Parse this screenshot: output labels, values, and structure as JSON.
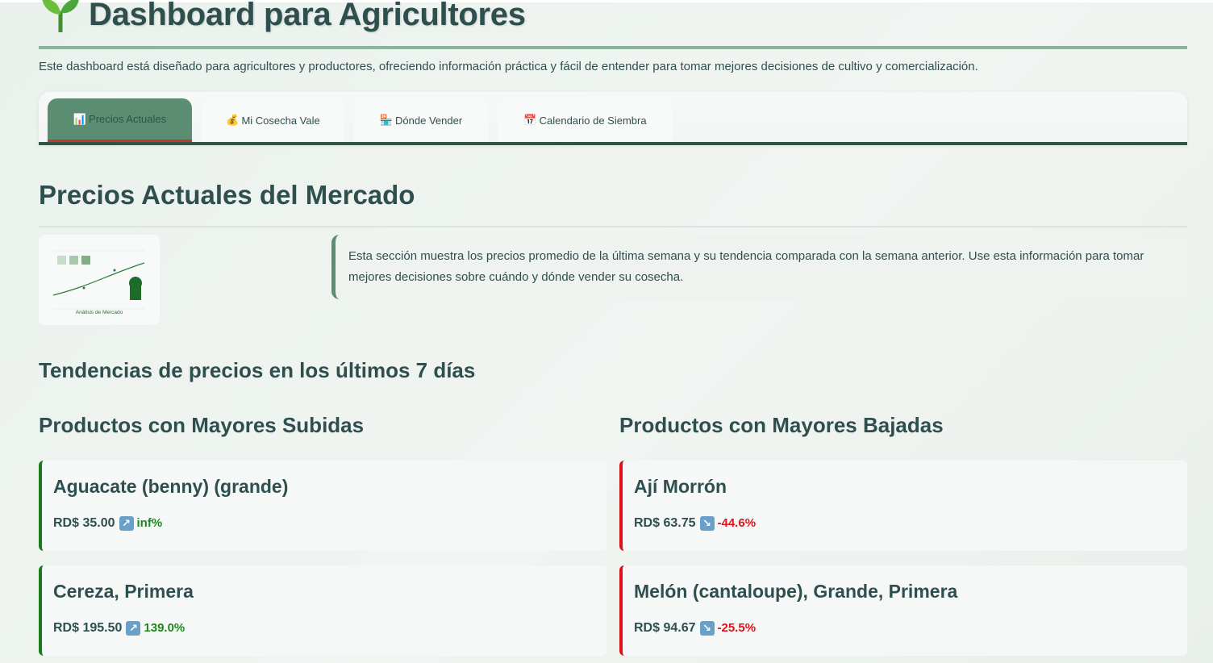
{
  "header": {
    "title": "Dashboard para Agricultores",
    "icon": "sprout-icon",
    "intro": "Este dashboard está diseñado para agricultores y productores, ofreciendo información práctica y fácil de entender para tomar mejores decisiones de cultivo y comercialización."
  },
  "tabs": [
    {
      "icon": "📊",
      "label": "Precios Actuales",
      "active": true
    },
    {
      "icon": "💰",
      "label": "Mi Cosecha Vale",
      "active": false
    },
    {
      "icon": "🏪",
      "label": "Dónde Vender",
      "active": false
    },
    {
      "icon": "📅",
      "label": "Calendario de Siembra",
      "active": false
    }
  ],
  "main": {
    "section_title": "Precios Actuales del Mercado",
    "thumbnail_caption": "Análisis de Mercado",
    "info_text": "Esta sección muestra los precios promedio de la última semana y su tendencia comparada con la semana anterior. Use esta información para tomar mejores decisiones sobre cuándo y dónde vender su cosecha.",
    "trends_title": "Tendencias de precios en los últimos 7 días",
    "rises": {
      "title": "Productos con Mayores Subidas",
      "items": [
        {
          "name": "Aguacate (benny) (grande)",
          "price": "RD$ 35.00",
          "arrow": "↗",
          "change": "inf%"
        },
        {
          "name": "Cereza, Primera",
          "price": "RD$ 195.50",
          "arrow": "↗",
          "change": "139.0%"
        }
      ]
    },
    "drops": {
      "title": "Productos con Mayores Bajadas",
      "items": [
        {
          "name": "Ají Morrón",
          "price": "RD$ 63.75",
          "arrow": "↘",
          "change": "-44.6%"
        },
        {
          "name": "Melón (cantaloupe), Grande, Primera",
          "price": "RD$ 94.67",
          "arrow": "↘",
          "change": "-25.5%"
        }
      ]
    }
  },
  "colors": {
    "accent": "#5b8d72",
    "up": "#1b8a1b",
    "down": "#e0111b",
    "text": "#2f4f4f"
  }
}
